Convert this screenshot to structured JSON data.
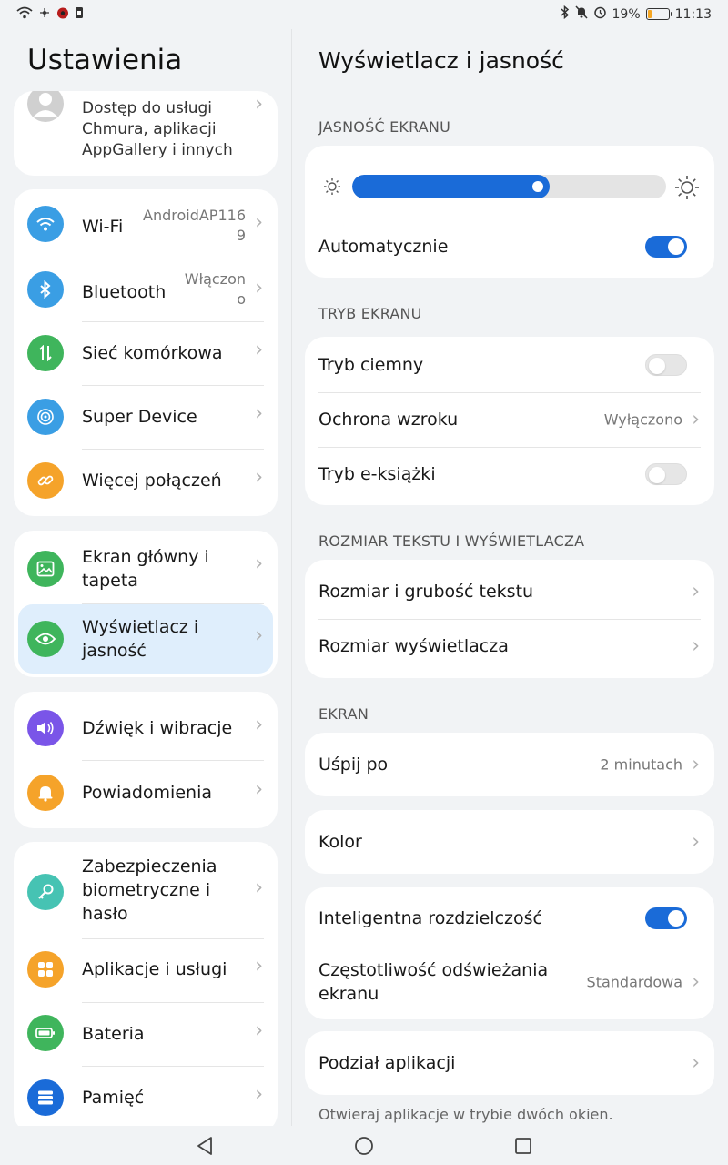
{
  "status": {
    "battery_percent": "19%",
    "time": "11:13",
    "battery_level": 0.19
  },
  "left": {
    "title": "Ustawienia",
    "account": {
      "line1": "Dostęp do usługi",
      "line2": "Chmura, aplikacji",
      "line3": "AppGallery i innych"
    },
    "groups": [
      [
        {
          "label": "Wi-Fi",
          "value1": "AndroidAP116",
          "value2": "9",
          "icon": "wifi-icon",
          "color": "#3a9ee4"
        },
        {
          "label": "Bluetooth",
          "value1": "Włączon",
          "value2": "o",
          "icon": "bluetooth-icon",
          "color": "#3a9ee4"
        },
        {
          "label": "Sieć komórkowa",
          "icon": "mobile-network-icon",
          "color": "#3fb55c"
        },
        {
          "label": "Super Device",
          "icon": "super-device-icon",
          "color": "#3a9ee4"
        },
        {
          "label": "Więcej połączeń",
          "icon": "link-icon",
          "color": "#f5a32a"
        }
      ],
      [
        {
          "label": "Ekran główny i",
          "label2": "tapeta",
          "icon": "wallpaper-icon",
          "color": "#3fb55c"
        },
        {
          "label": "Wyświetlacz i",
          "label2": "jasność",
          "icon": "eye-icon",
          "color": "#3fb55c"
        }
      ],
      [
        {
          "label": "Dźwięk i wibracje",
          "icon": "speaker-icon",
          "color": "#7a55e8"
        },
        {
          "label": "Powiadomienia",
          "icon": "bell-icon",
          "color": "#f5a32a"
        }
      ],
      [
        {
          "label": "Zabezpieczenia",
          "label2": "biometryczne i",
          "label3": "hasło",
          "icon": "key-icon",
          "color": "#46c3b3"
        },
        {
          "label": "Aplikacje i usługi",
          "icon": "apps-icon",
          "color": "#f5a32a"
        },
        {
          "label": "Bateria",
          "icon": "battery-icon",
          "color": "#3fb55c"
        },
        {
          "label": "Pamięć",
          "icon": "storage-icon",
          "color": "#1a6bd8"
        }
      ]
    ]
  },
  "right": {
    "title": "Wyświetlacz i jasność",
    "sections": {
      "brightness": "JASNOŚĆ EKRANU",
      "mode": "TRYB EKRANU",
      "text_size": "ROZMIAR TEKSTU I WYŚWIETLACZA",
      "screen": "EKRAN"
    },
    "brightness_level": 0.63,
    "auto_label": "Automatycznie",
    "dark_mode": "Tryb ciemny",
    "eye_comfort": "Ochrona wzroku",
    "eye_comfort_value": "Wyłączono",
    "ebook_mode": "Tryb e-książki",
    "text_size": "Rozmiar i grubość tekstu",
    "display_size": "Rozmiar wyświetlacza",
    "sleep": "Uśpij po",
    "sleep_value": "2 minutach",
    "color": "Kolor",
    "smart_resolution": "Inteligentna rozdzielczość",
    "refresh_rate_l1": "Częstotliwość odświeżania",
    "refresh_rate_l2": "ekranu",
    "refresh_rate_value": "Standardowa",
    "app_split": "Podział aplikacji",
    "app_split_note": "Otwieraj aplikacje w trybie dwóch okien.",
    "toggles": {
      "auto": true,
      "dark_mode": false,
      "ebook": false,
      "smart_resolution": true
    }
  }
}
